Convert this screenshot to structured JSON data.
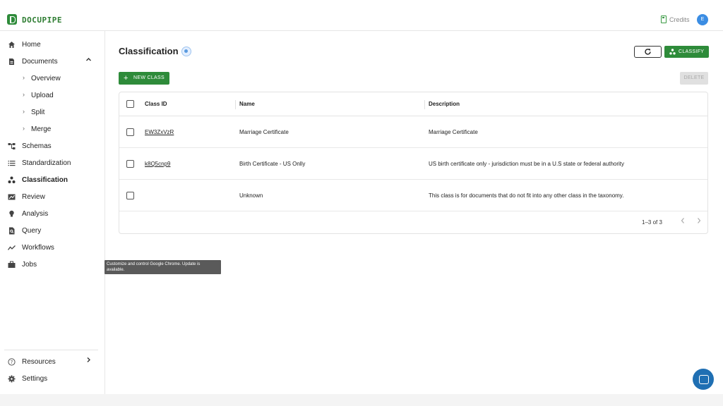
{
  "header": {
    "brand": "DOCUPIPE",
    "credits_label": "Credits",
    "avatar_initial": "E"
  },
  "sidebar": {
    "items": [
      {
        "label": "Home",
        "icon": "home-icon"
      },
      {
        "label": "Documents",
        "icon": "document-icon"
      },
      {
        "label": "Overview",
        "icon": "chevron-right-icon"
      },
      {
        "label": "Upload",
        "icon": "chevron-right-icon"
      },
      {
        "label": "Split",
        "icon": "chevron-right-icon"
      },
      {
        "label": "Merge",
        "icon": "chevron-right-icon"
      },
      {
        "label": "Schemas",
        "icon": "schema-icon"
      },
      {
        "label": "Standardization",
        "icon": "list-icon"
      },
      {
        "label": "Classification",
        "icon": "classification-icon"
      },
      {
        "label": "Review",
        "icon": "review-icon"
      },
      {
        "label": "Analysis",
        "icon": "lightbulb-icon"
      },
      {
        "label": "Query",
        "icon": "query-icon"
      },
      {
        "label": "Workflows",
        "icon": "workflow-icon"
      },
      {
        "label": "Jobs",
        "icon": "briefcase-icon"
      }
    ],
    "bottom": [
      {
        "label": "Resources",
        "icon": "help-icon"
      },
      {
        "label": "Settings",
        "icon": "gear-icon"
      }
    ]
  },
  "tooltip": {
    "text": "Customize and control Google Chrome. Update is available."
  },
  "main": {
    "title": "Classification",
    "classify_label": "CLASSIFY",
    "new_class_label": "NEW CLASS",
    "delete_label": "DELETE"
  },
  "table": {
    "columns": [
      "Class ID",
      "Name",
      "Description"
    ],
    "rows": [
      {
        "id": "EW3ZxVzR",
        "name": "Marriage Certificate",
        "description": "Marriage Certificate"
      },
      {
        "id": "k8Q5cnp9",
        "name": "Birth Certificate - US Onlly",
        "description": "US birth certificate only - jurisdiction must be in a U.S state or federal authority"
      },
      {
        "id": "",
        "name": "Unknown",
        "description": "This class is for documents that do not fit into any other class in the taxonomy."
      }
    ],
    "pagination": "1–3 of 3"
  },
  "colors": {
    "accent": "#2e8b3a",
    "brand_text": "#2e7d32",
    "avatar": "#3b8de3",
    "chat": "#1f6fb3"
  }
}
